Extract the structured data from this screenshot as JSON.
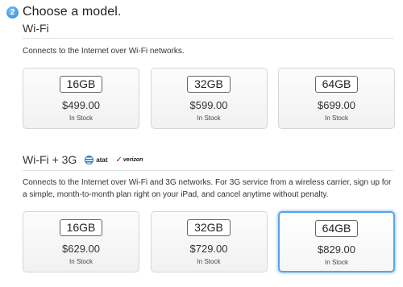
{
  "step": {
    "number": "2",
    "title": "Choose a model."
  },
  "wifi": {
    "heading": "Wi-Fi",
    "description": "Connects to the Internet over Wi-Fi networks.",
    "models": [
      {
        "capacity": "16GB",
        "price": "$499.00",
        "stock": "In Stock"
      },
      {
        "capacity": "32GB",
        "price": "$599.00",
        "stock": "In Stock"
      },
      {
        "capacity": "64GB",
        "price": "$699.00",
        "stock": "In Stock"
      }
    ]
  },
  "wifi3g": {
    "heading": "Wi-Fi + 3G",
    "carriers": {
      "att": "atat",
      "verizon": "verizon"
    },
    "description": "Connects to the Internet over Wi-Fi and 3G networks. For 3G service from a wireless carrier, sign up for a simple, month-to-month plan right on your iPad, and cancel anytime without penalty.",
    "models": [
      {
        "capacity": "16GB",
        "price": "$629.00",
        "stock": "In Stock"
      },
      {
        "capacity": "32GB",
        "price": "$729.00",
        "stock": "In Stock"
      },
      {
        "capacity": "64GB",
        "price": "$829.00",
        "stock": "In Stock",
        "selected": true
      }
    ]
  },
  "colors": {
    "accent": "#5aa2e8",
    "badge": "#2f86d4",
    "verizon_red": "#d0021b",
    "att_blue": "#2a79c4"
  }
}
